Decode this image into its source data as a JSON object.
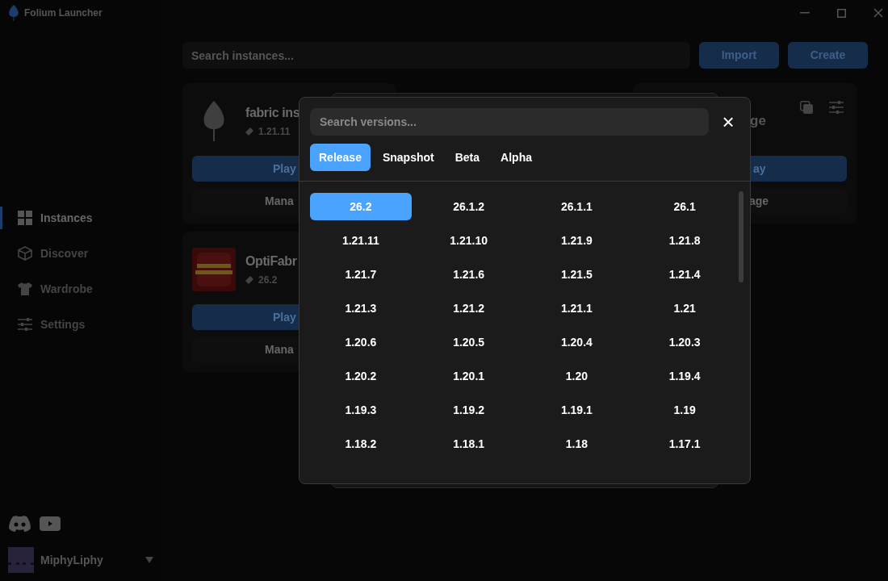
{
  "window": {
    "title": "Folium Launcher"
  },
  "sidebar": {
    "items": [
      {
        "label": "Instances",
        "selected": true
      },
      {
        "label": "Discover",
        "selected": false
      },
      {
        "label": "Wardrobe",
        "selected": false
      },
      {
        "label": "Settings",
        "selected": false
      }
    ],
    "account": {
      "name": "MiphyLiphy"
    }
  },
  "toolbar": {
    "search": {
      "placeholder": "Search instances..."
    },
    "buttons": [
      "Import",
      "Create"
    ]
  },
  "instances": [
    {
      "kind": "leaf",
      "name": "fabric ins",
      "version": "1.21.11",
      "play": "Play",
      "manage": "Mana"
    },
    {
      "kind": "optifabric",
      "name": "OptiFabr",
      "version": "26.2",
      "play": "Play",
      "manage": "Mana"
    },
    {
      "kind": "partial",
      "name": "ge",
      "play": "ay",
      "manage": "age"
    }
  ],
  "dialog": {
    "search": {
      "placeholder": "Search versions..."
    },
    "close": "×",
    "tabs": [
      {
        "label": "Release",
        "selected": true
      },
      {
        "label": "Snapshot",
        "selected": false
      },
      {
        "label": "Beta",
        "selected": false
      },
      {
        "label": "Alpha",
        "selected": false
      }
    ],
    "versions": [
      {
        "label": "26.2",
        "selected": true
      },
      {
        "label": "26.1.2",
        "selected": false
      },
      {
        "label": "26.1.1",
        "selected": false
      },
      {
        "label": "26.1",
        "selected": false
      },
      {
        "label": "1.21.11",
        "selected": false
      },
      {
        "label": "1.21.10",
        "selected": false
      },
      {
        "label": "1.21.9",
        "selected": false
      },
      {
        "label": "1.21.8",
        "selected": false
      },
      {
        "label": "1.21.7",
        "selected": false
      },
      {
        "label": "1.21.6",
        "selected": false
      },
      {
        "label": "1.21.5",
        "selected": false
      },
      {
        "label": "1.21.4",
        "selected": false
      },
      {
        "label": "1.21.3",
        "selected": false
      },
      {
        "label": "1.21.2",
        "selected": false
      },
      {
        "label": "1.21.1",
        "selected": false
      },
      {
        "label": "1.21",
        "selected": false
      },
      {
        "label": "1.20.6",
        "selected": false
      },
      {
        "label": "1.20.5",
        "selected": false
      },
      {
        "label": "1.20.4",
        "selected": false
      },
      {
        "label": "1.20.3",
        "selected": false
      },
      {
        "label": "1.20.2",
        "selected": false
      },
      {
        "label": "1.20.1",
        "selected": false
      },
      {
        "label": "1.20",
        "selected": false
      },
      {
        "label": "1.19.4",
        "selected": false
      },
      {
        "label": "1.19.3",
        "selected": false
      },
      {
        "label": "1.19.2",
        "selected": false
      },
      {
        "label": "1.19.1",
        "selected": false
      },
      {
        "label": "1.19",
        "selected": false
      },
      {
        "label": "1.18.2",
        "selected": false
      },
      {
        "label": "1.18.1",
        "selected": false
      },
      {
        "label": "1.18",
        "selected": false
      },
      {
        "label": "1.17.1",
        "selected": false
      }
    ]
  }
}
